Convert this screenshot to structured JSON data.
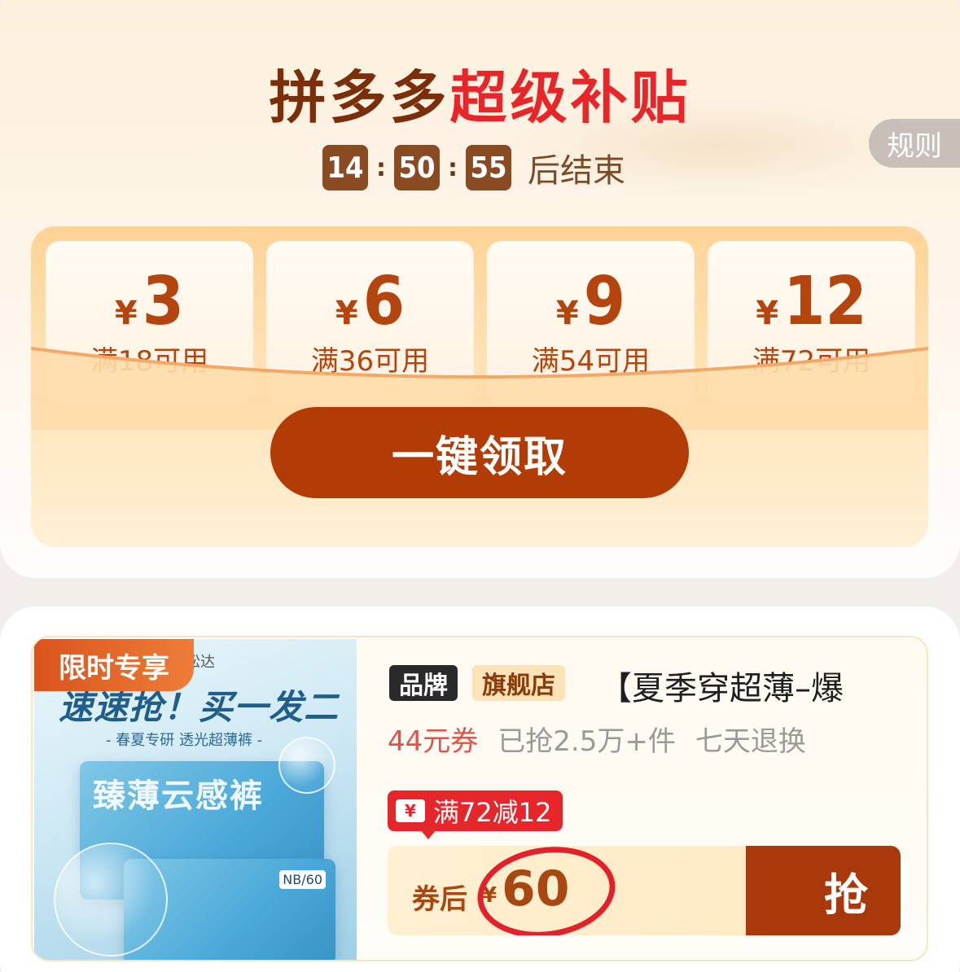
{
  "header": {
    "brand_part1": "拼多多",
    "brand_part2": "超级补贴",
    "countdown": {
      "hours": "14",
      "minutes": "50",
      "seconds": "55",
      "suffix": "后结束"
    },
    "rules_label": "规则"
  },
  "coupons": [
    {
      "yen": "¥",
      "amount": "3",
      "condition": "满18可用"
    },
    {
      "yen": "¥",
      "amount": "6",
      "condition": "满36可用"
    },
    {
      "yen": "¥",
      "amount": "9",
      "condition": "满54可用"
    },
    {
      "yen": "¥",
      "amount": "12",
      "condition": "满72可用"
    }
  ],
  "claim_button": "一键领取",
  "product": {
    "limited_tag": "限时专享",
    "image_title": "速速抢！买一发二",
    "image_subtitle": "- 春夏专研 透光超薄裤 -",
    "image_brand": "松达",
    "pack_label": "臻薄云感裤",
    "pack_size": "NB/60",
    "badge_brand": "品牌",
    "badge_store": "旗舰店",
    "title": "【夏季穿超薄–爆",
    "coupon_text": "44元券",
    "sold_text": "已抢2.5万+件",
    "return_text": "七天退换",
    "discount_icon": "¥",
    "discount_text": "满72减12",
    "price_label": "券后",
    "price_yen": "¥",
    "price_value": "60",
    "grab_label": "抢"
  },
  "colors": {
    "brand_dark": "#7a2e0a",
    "brand_red": "#e8262a",
    "button_brown": "#b33b06",
    "coupon_text": "#b5450e"
  }
}
